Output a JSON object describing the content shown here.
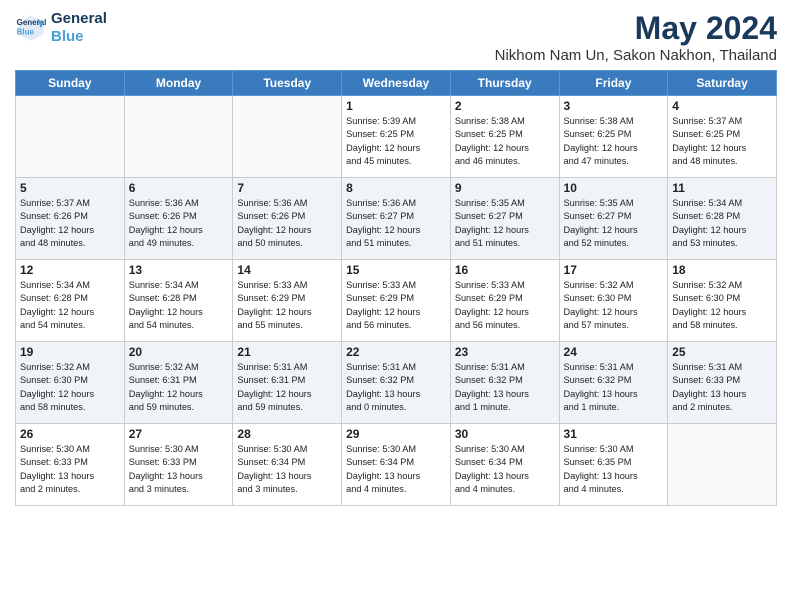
{
  "logo": {
    "line1": "General",
    "line2": "Blue"
  },
  "title": "May 2024",
  "subtitle": "Nikhom Nam Un, Sakon Nakhon, Thailand",
  "days_of_week": [
    "Sunday",
    "Monday",
    "Tuesday",
    "Wednesday",
    "Thursday",
    "Friday",
    "Saturday"
  ],
  "weeks": [
    {
      "alt": false,
      "days": [
        {
          "num": "",
          "info": ""
        },
        {
          "num": "",
          "info": ""
        },
        {
          "num": "",
          "info": ""
        },
        {
          "num": "1",
          "info": "Sunrise: 5:39 AM\nSunset: 6:25 PM\nDaylight: 12 hours\nand 45 minutes."
        },
        {
          "num": "2",
          "info": "Sunrise: 5:38 AM\nSunset: 6:25 PM\nDaylight: 12 hours\nand 46 minutes."
        },
        {
          "num": "3",
          "info": "Sunrise: 5:38 AM\nSunset: 6:25 PM\nDaylight: 12 hours\nand 47 minutes."
        },
        {
          "num": "4",
          "info": "Sunrise: 5:37 AM\nSunset: 6:25 PM\nDaylight: 12 hours\nand 48 minutes."
        }
      ]
    },
    {
      "alt": true,
      "days": [
        {
          "num": "5",
          "info": "Sunrise: 5:37 AM\nSunset: 6:26 PM\nDaylight: 12 hours\nand 48 minutes."
        },
        {
          "num": "6",
          "info": "Sunrise: 5:36 AM\nSunset: 6:26 PM\nDaylight: 12 hours\nand 49 minutes."
        },
        {
          "num": "7",
          "info": "Sunrise: 5:36 AM\nSunset: 6:26 PM\nDaylight: 12 hours\nand 50 minutes."
        },
        {
          "num": "8",
          "info": "Sunrise: 5:36 AM\nSunset: 6:27 PM\nDaylight: 12 hours\nand 51 minutes."
        },
        {
          "num": "9",
          "info": "Sunrise: 5:35 AM\nSunset: 6:27 PM\nDaylight: 12 hours\nand 51 minutes."
        },
        {
          "num": "10",
          "info": "Sunrise: 5:35 AM\nSunset: 6:27 PM\nDaylight: 12 hours\nand 52 minutes."
        },
        {
          "num": "11",
          "info": "Sunrise: 5:34 AM\nSunset: 6:28 PM\nDaylight: 12 hours\nand 53 minutes."
        }
      ]
    },
    {
      "alt": false,
      "days": [
        {
          "num": "12",
          "info": "Sunrise: 5:34 AM\nSunset: 6:28 PM\nDaylight: 12 hours\nand 54 minutes."
        },
        {
          "num": "13",
          "info": "Sunrise: 5:34 AM\nSunset: 6:28 PM\nDaylight: 12 hours\nand 54 minutes."
        },
        {
          "num": "14",
          "info": "Sunrise: 5:33 AM\nSunset: 6:29 PM\nDaylight: 12 hours\nand 55 minutes."
        },
        {
          "num": "15",
          "info": "Sunrise: 5:33 AM\nSunset: 6:29 PM\nDaylight: 12 hours\nand 56 minutes."
        },
        {
          "num": "16",
          "info": "Sunrise: 5:33 AM\nSunset: 6:29 PM\nDaylight: 12 hours\nand 56 minutes."
        },
        {
          "num": "17",
          "info": "Sunrise: 5:32 AM\nSunset: 6:30 PM\nDaylight: 12 hours\nand 57 minutes."
        },
        {
          "num": "18",
          "info": "Sunrise: 5:32 AM\nSunset: 6:30 PM\nDaylight: 12 hours\nand 58 minutes."
        }
      ]
    },
    {
      "alt": true,
      "days": [
        {
          "num": "19",
          "info": "Sunrise: 5:32 AM\nSunset: 6:30 PM\nDaylight: 12 hours\nand 58 minutes."
        },
        {
          "num": "20",
          "info": "Sunrise: 5:32 AM\nSunset: 6:31 PM\nDaylight: 12 hours\nand 59 minutes."
        },
        {
          "num": "21",
          "info": "Sunrise: 5:31 AM\nSunset: 6:31 PM\nDaylight: 12 hours\nand 59 minutes."
        },
        {
          "num": "22",
          "info": "Sunrise: 5:31 AM\nSunset: 6:32 PM\nDaylight: 13 hours\nand 0 minutes."
        },
        {
          "num": "23",
          "info": "Sunrise: 5:31 AM\nSunset: 6:32 PM\nDaylight: 13 hours\nand 1 minute."
        },
        {
          "num": "24",
          "info": "Sunrise: 5:31 AM\nSunset: 6:32 PM\nDaylight: 13 hours\nand 1 minute."
        },
        {
          "num": "25",
          "info": "Sunrise: 5:31 AM\nSunset: 6:33 PM\nDaylight: 13 hours\nand 2 minutes."
        }
      ]
    },
    {
      "alt": false,
      "days": [
        {
          "num": "26",
          "info": "Sunrise: 5:30 AM\nSunset: 6:33 PM\nDaylight: 13 hours\nand 2 minutes."
        },
        {
          "num": "27",
          "info": "Sunrise: 5:30 AM\nSunset: 6:33 PM\nDaylight: 13 hours\nand 3 minutes."
        },
        {
          "num": "28",
          "info": "Sunrise: 5:30 AM\nSunset: 6:34 PM\nDaylight: 13 hours\nand 3 minutes."
        },
        {
          "num": "29",
          "info": "Sunrise: 5:30 AM\nSunset: 6:34 PM\nDaylight: 13 hours\nand 4 minutes."
        },
        {
          "num": "30",
          "info": "Sunrise: 5:30 AM\nSunset: 6:34 PM\nDaylight: 13 hours\nand 4 minutes."
        },
        {
          "num": "31",
          "info": "Sunrise: 5:30 AM\nSunset: 6:35 PM\nDaylight: 13 hours\nand 4 minutes."
        },
        {
          "num": "",
          "info": ""
        }
      ]
    }
  ]
}
